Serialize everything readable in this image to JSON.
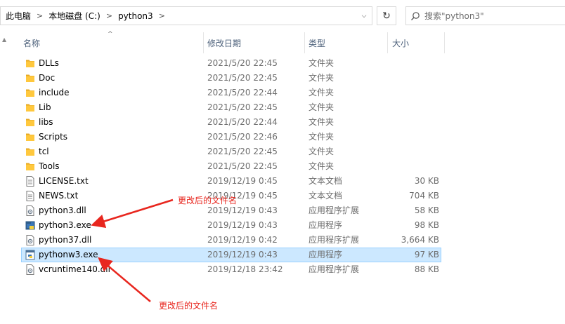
{
  "address": {
    "crumbs": [
      "此电脑",
      "本地磁盘 (C:)",
      "python3"
    ],
    "search_placeholder": "搜索\"python3\""
  },
  "columns": {
    "name": "名称",
    "date": "修改日期",
    "type": "类型",
    "size": "大小"
  },
  "files": [
    {
      "name": "DLLs",
      "date": "2021/5/20 22:45",
      "type": "文件夹",
      "size": "",
      "icon": "folder-icon"
    },
    {
      "name": "Doc",
      "date": "2021/5/20 22:45",
      "type": "文件夹",
      "size": "",
      "icon": "folder-icon"
    },
    {
      "name": "include",
      "date": "2021/5/20 22:44",
      "type": "文件夹",
      "size": "",
      "icon": "folder-icon"
    },
    {
      "name": "Lib",
      "date": "2021/5/20 22:45",
      "type": "文件夹",
      "size": "",
      "icon": "folder-icon"
    },
    {
      "name": "libs",
      "date": "2021/5/20 22:44",
      "type": "文件夹",
      "size": "",
      "icon": "folder-icon"
    },
    {
      "name": "Scripts",
      "date": "2021/5/20 22:46",
      "type": "文件夹",
      "size": "",
      "icon": "folder-icon"
    },
    {
      "name": "tcl",
      "date": "2021/5/20 22:45",
      "type": "文件夹",
      "size": "",
      "icon": "folder-icon"
    },
    {
      "name": "Tools",
      "date": "2021/5/20 22:45",
      "type": "文件夹",
      "size": "",
      "icon": "folder-icon"
    },
    {
      "name": "LICENSE.txt",
      "date": "2019/12/19 0:45",
      "type": "文本文档",
      "size": "30 KB",
      "icon": "text-file-icon"
    },
    {
      "name": "NEWS.txt",
      "date": "2019/12/19 0:45",
      "type": "文本文档",
      "size": "704 KB",
      "icon": "text-file-icon"
    },
    {
      "name": "python3.dll",
      "date": "2019/12/19 0:43",
      "type": "应用程序扩展",
      "size": "58 KB",
      "icon": "dll-file-icon"
    },
    {
      "name": "python3.exe",
      "date": "2019/12/19 0:43",
      "type": "应用程序",
      "size": "98 KB",
      "icon": "python-exe-icon"
    },
    {
      "name": "python37.dll",
      "date": "2019/12/19 0:42",
      "type": "应用程序扩展",
      "size": "3,664 KB",
      "icon": "dll-file-icon"
    },
    {
      "name": "pythonw3.exe",
      "date": "2019/12/19 0:43",
      "type": "应用程序",
      "size": "97 KB",
      "icon": "pythonw-exe-icon",
      "selected": true
    },
    {
      "name": "vcruntime140.dll",
      "date": "2019/12/18 23:42",
      "type": "应用程序扩展",
      "size": "88 KB",
      "icon": "dll-file-icon"
    }
  ],
  "annotations": {
    "label_1": "更改后的文件名",
    "label_2": "更改后的文件名",
    "color": "#e8261e"
  },
  "colors": {
    "selection_bg": "#cce8ff",
    "selection_border": "#99d1ff",
    "folder": "#ffc83d",
    "header_text": "#4c607a"
  }
}
